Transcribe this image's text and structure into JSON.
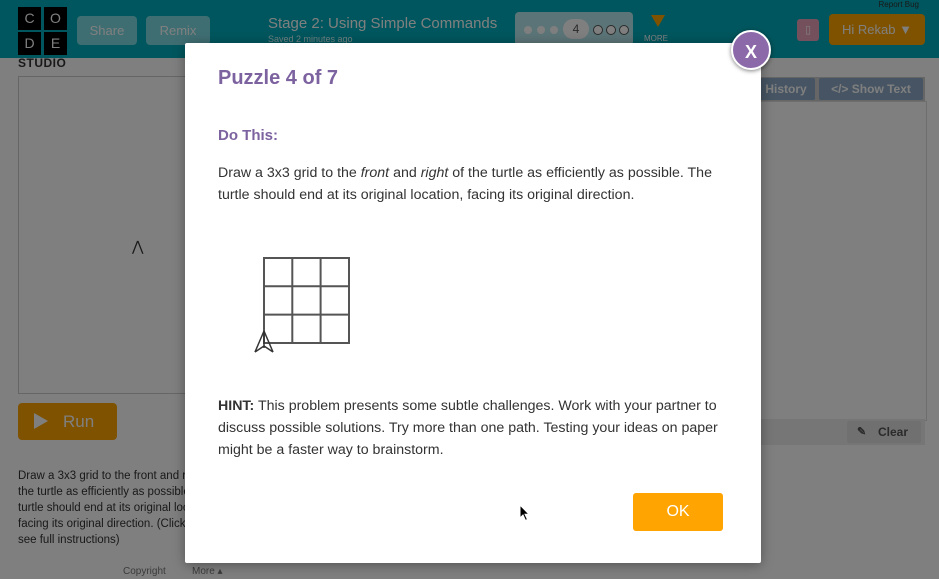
{
  "header": {
    "logo_letters": [
      "C",
      "O",
      "D",
      "E"
    ],
    "studio_label": "STUDIO",
    "share_label": "Share",
    "remix_label": "Remix",
    "stage_title": "Stage 2: Using Simple Commands",
    "saved_text": "Saved 2 minutes ago",
    "current_level": "4",
    "more_label": "MORE",
    "report_bug": "Report Bug",
    "user_label": "Hi Rekab ▼"
  },
  "workspace": {
    "history_label": "History",
    "show_text_label": "</> Show Text",
    "clear_label": "Clear"
  },
  "run_label": "Run",
  "instructions": "Draw a 3x3 grid to the front and right of the turtle as efficiently as possible. The turtle should end at its original location, facing its original direction. (Click to see full instructions)",
  "footer": {
    "copyright": "Copyright",
    "more": "More ▴"
  },
  "dialog": {
    "close_label": "X",
    "title": "Puzzle 4 of 7",
    "subtitle": "Do This:",
    "body_part1": "Draw a 3x3 grid to the ",
    "body_front": "front",
    "body_and": " and ",
    "body_right": "right",
    "body_part2": " of the turtle as efficiently as possible. The turtle should end at its original location, facing its original direction.",
    "hint_label": "HINT:",
    "hint_text": " This problem presents some subtle challenges. Work with your partner to discuss possible solutions. Try more than one path. Testing your ideas on paper might be a faster way to brainstorm.",
    "ok_label": "OK"
  },
  "colors": {
    "header_bg": "#00adbc",
    "accent_orange": "#ffa400",
    "title_purple": "#7d62a0",
    "close_purple": "#8c6aaa"
  }
}
